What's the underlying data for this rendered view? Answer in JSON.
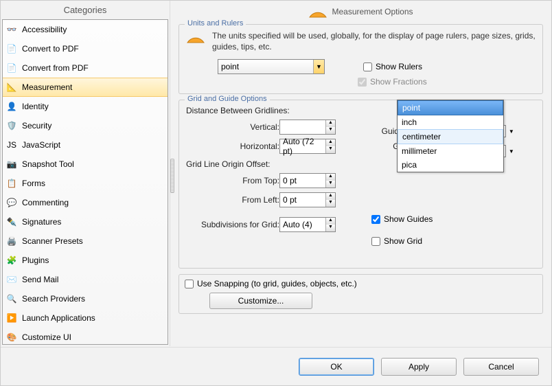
{
  "sidebar": {
    "header": "Categories",
    "items": [
      {
        "label": "Accessibility",
        "icon": "👓"
      },
      {
        "label": "Convert to PDF",
        "icon": "📄"
      },
      {
        "label": "Convert from PDF",
        "icon": "📄"
      },
      {
        "label": "Measurement",
        "icon": "📐",
        "selected": true
      },
      {
        "label": "Identity",
        "icon": "👤"
      },
      {
        "label": "Security",
        "icon": "🛡️"
      },
      {
        "label": "JavaScript",
        "icon": "JS"
      },
      {
        "label": "Snapshot Tool",
        "icon": "📷"
      },
      {
        "label": "Forms",
        "icon": "📋"
      },
      {
        "label": "Commenting",
        "icon": "💬"
      },
      {
        "label": "Signatures",
        "icon": "✒️"
      },
      {
        "label": "Scanner Presets",
        "icon": "🖨️"
      },
      {
        "label": "Plugins",
        "icon": "🧩"
      },
      {
        "label": "Send Mail",
        "icon": "✉️"
      },
      {
        "label": "Search Providers",
        "icon": "🔍"
      },
      {
        "label": "Launch Applications",
        "icon": "▶️"
      },
      {
        "label": "Customize UI",
        "icon": "🎨"
      }
    ]
  },
  "header": {
    "title": "Measurement Options"
  },
  "units": {
    "legend": "Units and Rulers",
    "desc": "The units specified will be used, globally, for the display of page rulers, page sizes, grids, guides, tips, etc.",
    "combo_value": "point",
    "options": [
      "point",
      "inch",
      "centimeter",
      "millimeter",
      "pica"
    ],
    "show_rulers_label": "Show Rulers",
    "show_fractions_label": "Show Fractions"
  },
  "grid": {
    "legend": "Grid and Guide Options",
    "distance_label": "Distance Between Gridlines:",
    "vertical_label": "Vertical:",
    "horizontal_label": "Horizontal:",
    "horizontal_value": "Auto (72 pt)",
    "origin_label": "Grid Line Origin Offset:",
    "from_top_label": "From Top:",
    "from_top_value": "0 pt",
    "from_left_label": "From Left:",
    "from_left_value": "0 pt",
    "subdiv_label": "Subdivisions for Grid:",
    "subdiv_value": "Auto (4)",
    "guide_style_label": "Guide Style:",
    "grid_line_style_label": "Grid Line Style:",
    "show_guides_label": "Show Guides",
    "show_grid_label": "Show Grid",
    "guide_color": "#d84fe0",
    "grid_color": "#6b7df5"
  },
  "snapping": {
    "label": "Use Snapping (to grid, guides, objects, etc.)",
    "customize_label": "Customize..."
  },
  "buttons": {
    "ok": "OK",
    "apply": "Apply",
    "cancel": "Cancel"
  }
}
